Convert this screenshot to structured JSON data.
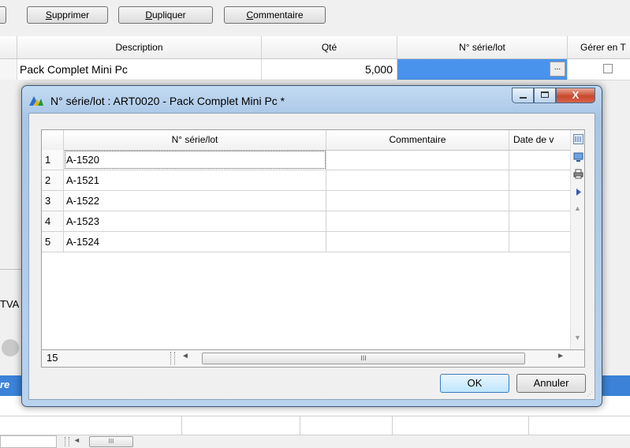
{
  "toolbar": {
    "buttons": [
      {
        "prefix": "",
        "hotkey": "S",
        "rest": "upprimer"
      },
      {
        "prefix": "",
        "hotkey": "D",
        "rest": "upliquer"
      },
      {
        "prefix": "",
        "hotkey": "C",
        "rest": "ommentaire"
      }
    ]
  },
  "main_grid": {
    "headers": {
      "description": "Description",
      "qty": "Qté",
      "serial": "N° série/lot",
      "manage": "Gérer en T"
    },
    "row": {
      "description": "Pack Complet Mini Pc",
      "qty": "5,000",
      "serial": "",
      "ellipsis": "...",
      "manage_checked": false
    }
  },
  "background": {
    "tva_label": "TVA",
    "blue_bar_text": "re"
  },
  "dialog": {
    "title": "N° série/lot : ART0020 - Pack Complet Mini Pc *",
    "close_label": "X",
    "columns": {
      "serial": "N° série/lot",
      "comment": "Commentaire",
      "date": "Date de v"
    },
    "rows": [
      {
        "num": "1",
        "serial": "A-1520",
        "comment": "",
        "date": ""
      },
      {
        "num": "2",
        "serial": "A-1521",
        "comment": "",
        "date": ""
      },
      {
        "num": "3",
        "serial": "A-1522",
        "comment": "",
        "date": ""
      },
      {
        "num": "4",
        "serial": "A-1523",
        "comment": "",
        "date": ""
      },
      {
        "num": "5",
        "serial": "A-1524",
        "comment": "",
        "date": ""
      }
    ],
    "footer_count": "15",
    "scroll_thumb": "III",
    "ok_label": "OK",
    "cancel_label": "Annuler"
  },
  "bottom_scroll_thumb": "III",
  "colors": {
    "selection_blue": "#4a93ec",
    "title_bar": "#b9d2ee",
    "close_red": "#c84a2e"
  }
}
